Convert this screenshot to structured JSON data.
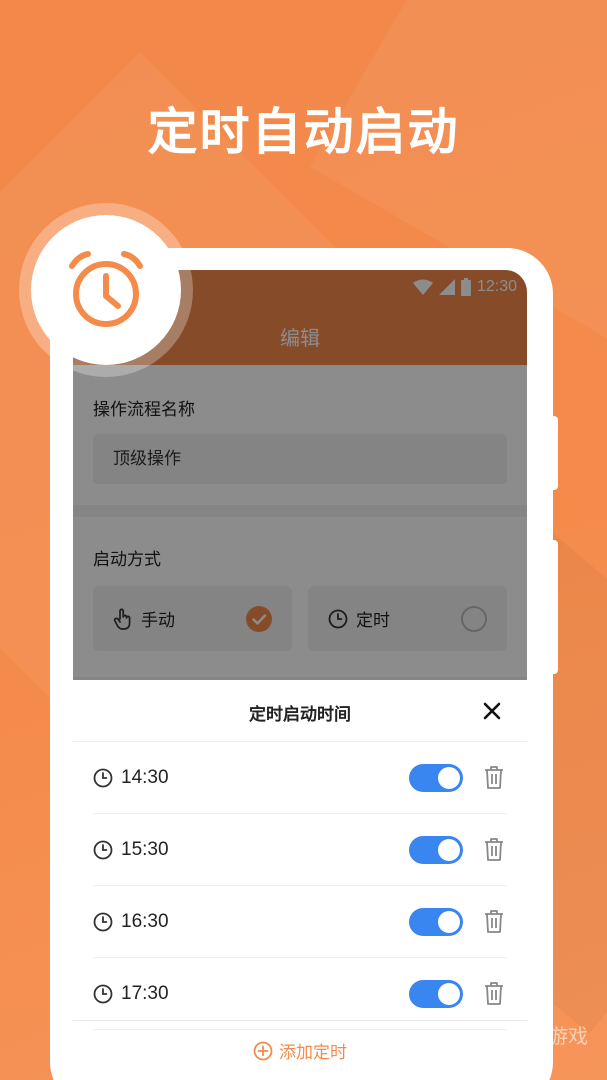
{
  "promo": {
    "headline": "定时自动启动",
    "watermark": "游戏"
  },
  "status_bar": {
    "time": "12:30",
    "icons": [
      "wifi-icon",
      "signal-icon",
      "battery-icon"
    ]
  },
  "app_bar": {
    "title": "编辑"
  },
  "form": {
    "flow_name_label": "操作流程名称",
    "flow_name_value": "顶级操作",
    "start_mode_label": "启动方式",
    "modes": [
      {
        "label": "手动",
        "icon": "hand-icon",
        "selected": true
      },
      {
        "label": "定时",
        "icon": "clock-icon",
        "selected": false
      }
    ]
  },
  "sheet": {
    "title": "定时启动时间",
    "times": [
      {
        "time": "14:30",
        "enabled": true
      },
      {
        "time": "15:30",
        "enabled": true
      },
      {
        "time": "16:30",
        "enabled": true
      },
      {
        "time": "17:30",
        "enabled": true
      }
    ],
    "add_label": "添加定时"
  },
  "colors": {
    "accent": "#f48b4b",
    "toggle_on": "#3a86f0"
  }
}
